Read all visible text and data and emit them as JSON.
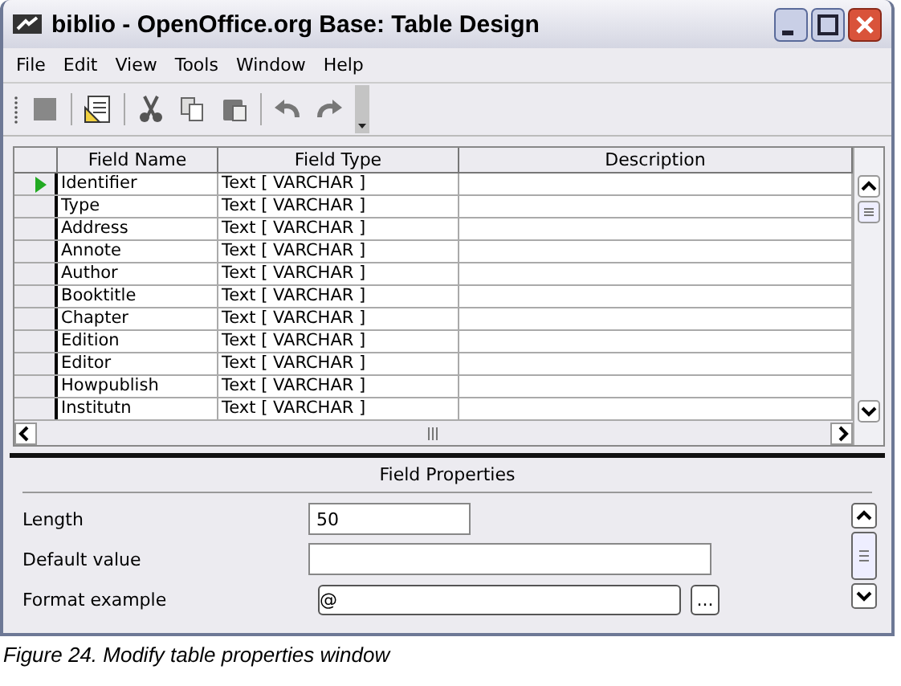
{
  "window": {
    "title": "biblio - OpenOffice.org Base: Table Design"
  },
  "menu": [
    "File",
    "Edit",
    "View",
    "Tools",
    "Window",
    "Help"
  ],
  "table": {
    "columns": [
      "Field Name",
      "Field Type",
      "Description"
    ],
    "rows": [
      {
        "name": "Identifier",
        "type": "Text [ VARCHAR ]",
        "selected": true
      },
      {
        "name": "Type",
        "type": "Text [ VARCHAR ]",
        "selected": false
      },
      {
        "name": "Address",
        "type": "Text [ VARCHAR ]",
        "selected": false
      },
      {
        "name": "Annote",
        "type": "Text [ VARCHAR ]",
        "selected": false
      },
      {
        "name": "Author",
        "type": "Text [ VARCHAR ]",
        "selected": false
      },
      {
        "name": "Booktitle",
        "type": "Text [ VARCHAR ]",
        "selected": false
      },
      {
        "name": "Chapter",
        "type": "Text [ VARCHAR ]",
        "selected": false
      },
      {
        "name": "Edition",
        "type": "Text [ VARCHAR ]",
        "selected": false
      },
      {
        "name": "Editor",
        "type": "Text [ VARCHAR ]",
        "selected": false
      },
      {
        "name": "Howpublish",
        "type": "Text [ VARCHAR ]",
        "selected": false
      },
      {
        "name": "Institutn",
        "type": "Text [ VARCHAR ]",
        "selected": false
      }
    ]
  },
  "field_properties": {
    "title": "Field Properties",
    "fields": [
      {
        "label": "Length",
        "value": "50",
        "kind": "short"
      },
      {
        "label": "Default value",
        "kind": "long"
      },
      {
        "label": "Format example",
        "value": "@",
        "kind": "browse"
      }
    ]
  },
  "browse_button": "...",
  "caption": "Figure 24. Modify table properties window"
}
